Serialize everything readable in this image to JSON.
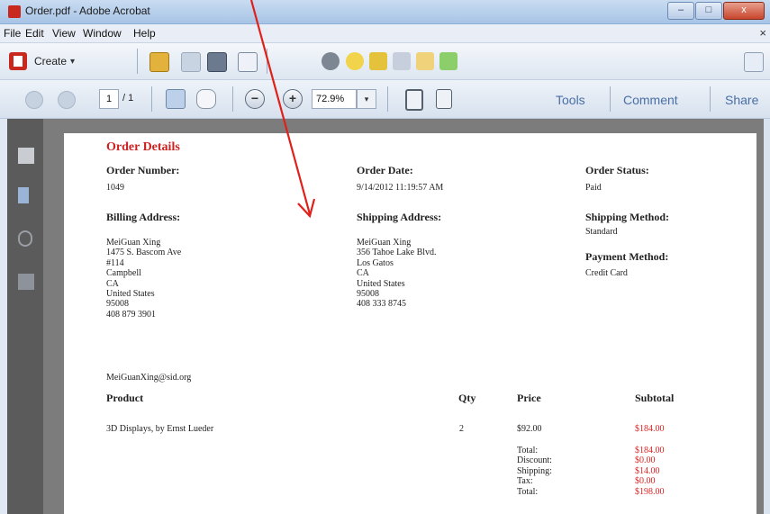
{
  "window": {
    "title": "Order.pdf - Adobe Acrobat",
    "controls": {
      "minimize": "–",
      "maximize": "□",
      "close": "x"
    }
  },
  "menu": {
    "items": [
      "File",
      "Edit",
      "View",
      "Window",
      "Help"
    ],
    "close_glyph": "×"
  },
  "toolbar": {
    "create_label": "Create",
    "create_caret": "▾"
  },
  "navigation": {
    "page_current": "1",
    "page_total": "/ 1",
    "zoom_value": "72.9%",
    "zoom_caret": "▾",
    "zoom_out_glyph": "−",
    "zoom_in_glyph": "+",
    "right_tabs": [
      "Tools",
      "Comment",
      "Share"
    ]
  },
  "document": {
    "title": "Order Details",
    "order_number_label": "Order Number:",
    "order_number": "1049",
    "order_date_label": "Order Date:",
    "order_date": "9/14/2012 11:19:57 AM",
    "order_status_label": "Order Status:",
    "order_status": "Paid",
    "billing_label": "Billing Address:",
    "billing_lines": [
      "MeiGuan Xing",
      "1475 S. Bascom Ave",
      "#114",
      "Campbell",
      "CA",
      "United States",
      "95008",
      "408 879 3901"
    ],
    "shipping_label": "Shipping Address:",
    "shipping_lines": [
      "MeiGuan Xing",
      "356 Tahoe Lake Blvd.",
      "Los Gatos",
      "CA",
      "United States",
      "95008",
      "408 333 8745"
    ],
    "shipping_method_label": "Shipping Method:",
    "shipping_method": "Standard",
    "payment_method_label": "Payment Method:",
    "payment_method": "Credit Card",
    "email": "MeiGuanXing@sid.org",
    "table_headers": {
      "product": "Product",
      "qty": "Qty",
      "price": "Price",
      "subtotal": "Subtotal"
    },
    "line_item": {
      "product": "3D Displays, by Ernst Lueder",
      "qty": "2",
      "price": "$92.00",
      "subtotal": "$184.00"
    },
    "totals_labels": [
      "Total:",
      "Discount:",
      "Shipping:",
      "Tax:",
      "Total:"
    ],
    "totals_values": [
      "$184.00",
      "$0.00",
      "$14.00",
      "$0.00",
      "$198.00"
    ]
  },
  "colors": {
    "accent_red": "#cc2222",
    "annotation_arrow": "#e0201a"
  }
}
